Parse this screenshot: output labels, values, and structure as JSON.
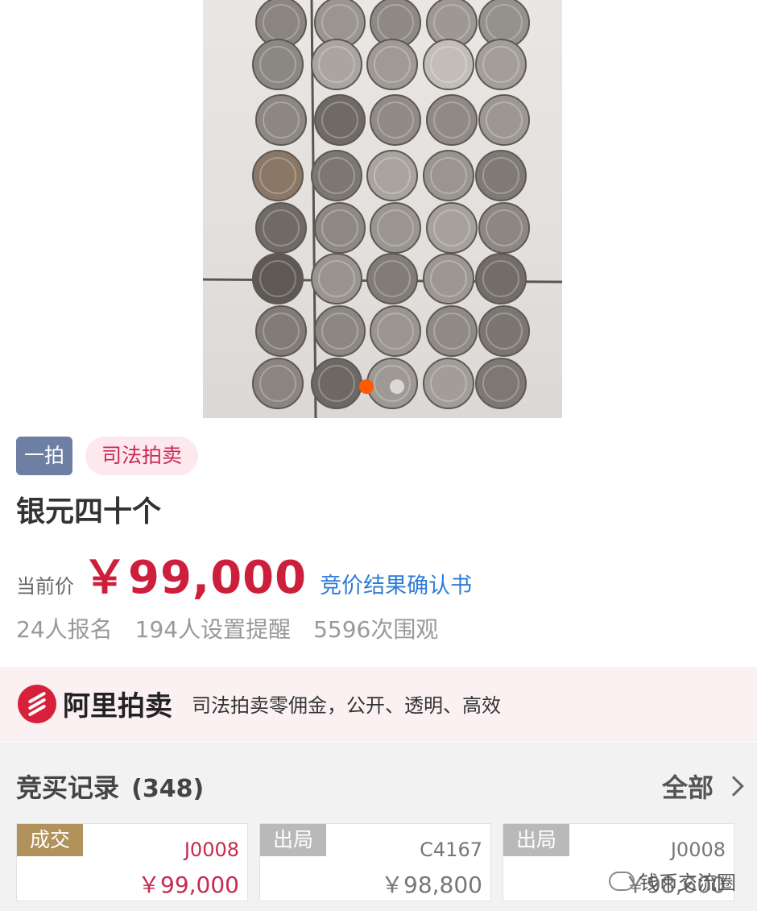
{
  "gallery": {
    "total_images": 2,
    "active_index": 0,
    "coin_rows": [
      [
        {
          "c": "#8a8581"
        },
        {
          "c": "#9a958f"
        },
        {
          "c": "#8e8984"
        },
        {
          "c": "#9d9893"
        },
        {
          "c": "#95918c"
        }
      ],
      [
        {
          "c": "#8b8783"
        },
        {
          "c": "#aaa5a0"
        },
        {
          "c": "#9f9a95"
        },
        {
          "c": "#c2bdb7"
        },
        {
          "c": "#a39e98"
        }
      ],
      [
        {
          "c": "#8c8782"
        },
        {
          "c": "#6f6a66"
        },
        {
          "c": "#908b86"
        },
        {
          "c": "#8f8a86"
        },
        {
          "c": "#9c9792"
        }
      ],
      [
        {
          "c": "#8a7765"
        },
        {
          "c": "#7d7772"
        },
        {
          "c": "#a9a49e"
        },
        {
          "c": "#9a958f"
        },
        {
          "c": "#7f7a75"
        }
      ],
      [
        {
          "c": "#6f6a66"
        },
        {
          "c": "#8e8883"
        },
        {
          "c": "#9a958f"
        },
        {
          "c": "#a6a19b"
        },
        {
          "c": "#8c8782"
        }
      ],
      [
        {
          "c": "#5e5955"
        },
        {
          "c": "#99948e"
        },
        {
          "c": "#817c77"
        },
        {
          "c": "#9c9792"
        },
        {
          "c": "#726d68"
        }
      ],
      [
        {
          "c": "#817c77"
        },
        {
          "c": "#8c8782"
        },
        {
          "c": "#9a958f"
        },
        {
          "c": "#8f8a85"
        },
        {
          "c": "#7b7671"
        }
      ],
      [
        {
          "c": "#8a8580"
        },
        {
          "c": "#6d6864"
        },
        {
          "c": "#9e9994"
        },
        {
          "c": "#a29d98"
        },
        {
          "c": "#7d7873"
        }
      ]
    ]
  },
  "tags": {
    "round": "一拍",
    "type": "司法拍卖"
  },
  "item": {
    "title": "银元四十个",
    "price_label": "当前价",
    "price": "￥99,000",
    "result_link": "竞价结果确认书"
  },
  "stats": {
    "signups": "24人报名",
    "reminders": "194人设置提醒",
    "views": "5596次围观"
  },
  "banner": {
    "brand": "阿里拍卖",
    "slogan": "司法拍卖零佣金，公开、透明、高效"
  },
  "bids": {
    "title": "竞买记录",
    "count": "(348)",
    "all_label": "全部",
    "records": [
      {
        "status": "成交",
        "code": "J0008",
        "amount": "￥99,000",
        "won": true
      },
      {
        "status": "出局",
        "code": "C4167",
        "amount": "￥98,800",
        "won": false
      },
      {
        "status": "出局",
        "code": "J0008",
        "amount": "￥98,600",
        "won": false
      }
    ]
  },
  "watermark": {
    "text": "钱币交流圈"
  }
}
